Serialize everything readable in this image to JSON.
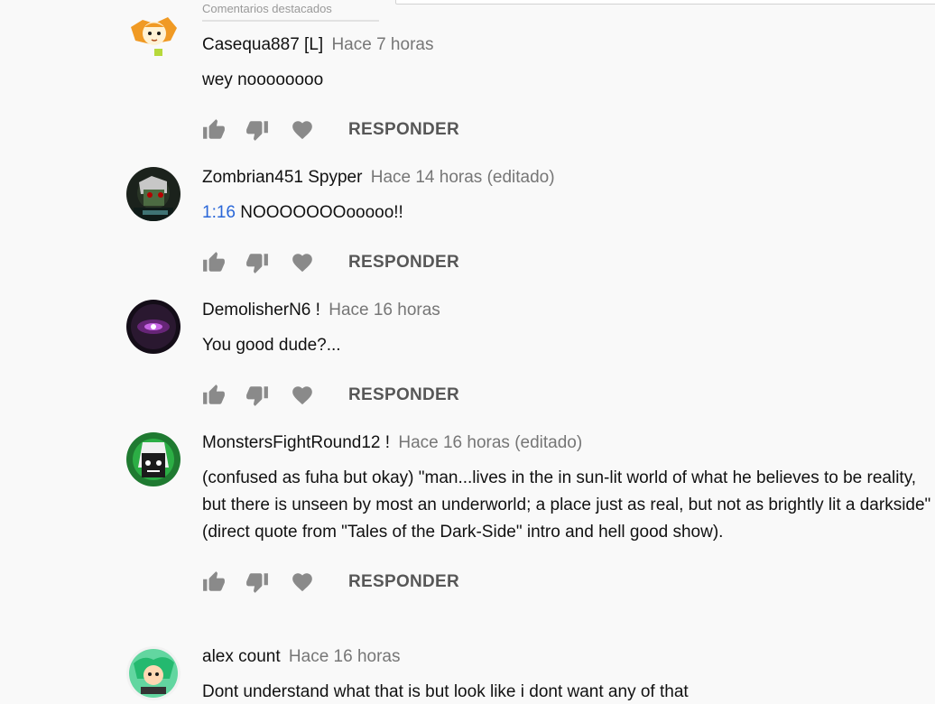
{
  "top": {
    "tab_label": "Comentarios destacados"
  },
  "comments": [
    {
      "author": "Casequa887 [L]",
      "time": "Hace 7 horas",
      "text": "wey noooooooo",
      "timestamp_link": "",
      "reply_label": "RESPONDER",
      "avatar_icon": "orange-character-avatar"
    },
    {
      "author": "Zombrian451 Spyper",
      "time": "Hace 14 horas (editado)",
      "text": "NOOOOOOOooooo!!",
      "timestamp_link": "1:16",
      "reply_label": "RESPONDER",
      "avatar_icon": "zombie-avatar"
    },
    {
      "author": "DemolisherN6 !",
      "time": "Hace 16 horas",
      "text": "You good dude?...",
      "timestamp_link": "",
      "reply_label": "RESPONDER",
      "avatar_icon": "purple-glow-avatar"
    },
    {
      "author": "MonstersFightRound12 !",
      "time": "Hace 16 horas (editado)",
      "text": "(confused as fuha but okay) \"man...lives in the in sun-lit world of what he believes to be reality, but there is unseen by most an underworld; a place just as real, but not as brightly lit a darkside\" (direct quote from \"Tales of the Dark-Side\" intro and hell good show).",
      "timestamp_link": "",
      "reply_label": "RESPONDER",
      "avatar_icon": "green-creature-avatar"
    },
    {
      "author": "alex count",
      "time": "Hace 16 horas",
      "text": "Dont understand what that is but look like i dont want any of that",
      "timestamp_link": "",
      "reply_label": "RESPONDER",
      "avatar_icon": "green-squid-avatar"
    }
  ],
  "colors": {
    "background": "#f9f9f9",
    "author": "#111111",
    "meta": "#767676",
    "link": "#2a67d8",
    "action": "#575757"
  },
  "icons": {
    "like": "thumb-up-icon",
    "dislike": "thumb-down-icon",
    "heart": "heart-icon"
  }
}
